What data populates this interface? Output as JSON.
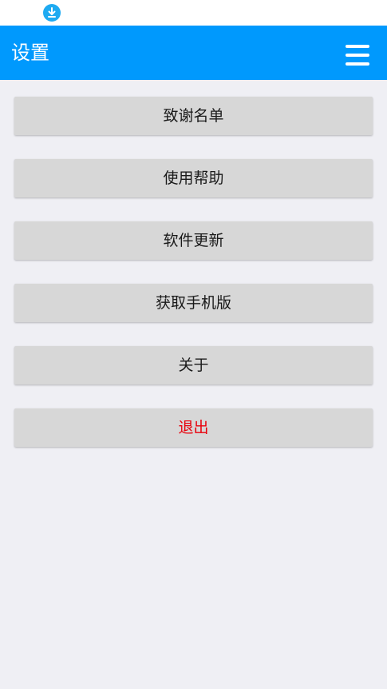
{
  "status_bar": {
    "icons": [
      "download-icon"
    ],
    "colors": {
      "download_icon": "#1eaaf1"
    }
  },
  "app_bar": {
    "title": "设置",
    "menu_icon": "hamburger-menu-icon",
    "background": "#0099fd"
  },
  "menu": {
    "items": [
      {
        "label": "致谢名单"
      },
      {
        "label": "使用帮助"
      },
      {
        "label": "软件更新"
      },
      {
        "label": "获取手机版"
      },
      {
        "label": "关于"
      },
      {
        "label": "退出",
        "color": "#e8000b"
      }
    ]
  }
}
